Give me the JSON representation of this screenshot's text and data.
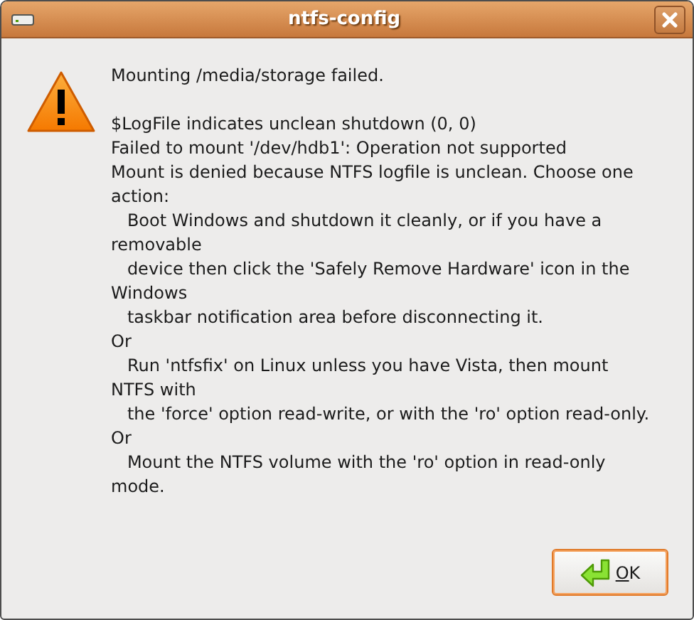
{
  "window": {
    "title": "ntfs-config"
  },
  "message": {
    "heading": "Mounting /media/storage failed.",
    "lines": [
      "$LogFile indicates unclean shutdown (0, 0)",
      "Failed to mount '/dev/hdb1': Operation not supported",
      "Mount is denied because NTFS logfile is unclean. Choose one",
      "action:",
      "   Boot Windows and shutdown it cleanly, or if you have a",
      "removable",
      "   device then click the 'Safely Remove Hardware' icon in the",
      "Windows",
      "   taskbar notification area before disconnecting it.",
      "Or",
      "   Run 'ntfsfix' on Linux unless you have Vista, then mount",
      "NTFS with",
      "   the 'force' option read-write, or with the 'ro' option read-only.",
      "Or",
      "   Mount the NTFS volume with the 'ro' option in read-only",
      "mode."
    ]
  },
  "buttons": [
    {
      "mnemonic": "O",
      "label_rest": "K",
      "focused": true
    }
  ]
}
